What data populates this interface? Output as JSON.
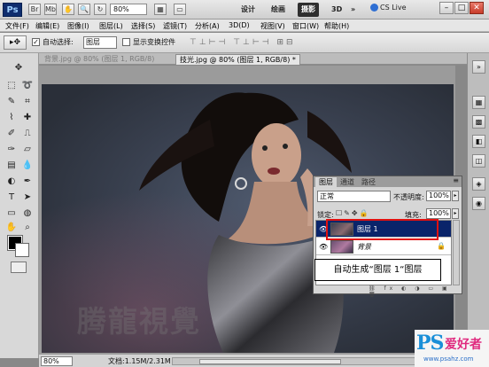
{
  "appbar": {
    "logo": "Ps",
    "zoom_value": "80%",
    "workspaces": [
      {
        "label": "设计",
        "active": false
      },
      {
        "label": "绘画",
        "active": false
      },
      {
        "label": "摄影",
        "active": true
      },
      {
        "label": "3D",
        "active": false
      }
    ],
    "cs_live": "CS Live",
    "window_controls": [
      "minimize-icon",
      "maximize-icon",
      "close-icon"
    ]
  },
  "menubar": {
    "items": [
      "文件(F)",
      "编辑(E)",
      "图像(I)",
      "图层(L)",
      "选择(S)",
      "滤镜(T)",
      "分析(A)",
      "3D(D)",
      "视图(V)",
      "窗口(W)",
      "帮助(H)"
    ]
  },
  "options": {
    "auto_select_label": "自动选择:",
    "auto_select_value": "图层",
    "show_transform_label": "显示变换控件"
  },
  "doc_tabs": [
    {
      "label": "背景.jpg @ 80% (图层 1, RGB/8)",
      "active": false
    },
    {
      "label": "技光.jpg @ 80% (图层 1, RGB/8) *",
      "active": true
    }
  ],
  "canvas": {
    "watermark": "腾龍視覺"
  },
  "status": {
    "zoom": "80%",
    "doc_size": "文档:1.15M/2.31M"
  },
  "layers_panel": {
    "tabs": [
      {
        "label": "图层",
        "active": true
      },
      {
        "label": "通道",
        "active": false
      },
      {
        "label": "路径",
        "active": false
      }
    ],
    "blend_mode": "正常",
    "opacity_label": "不透明度:",
    "opacity_value": "100%",
    "lock_label": "锁定:",
    "fill_label": "填充:",
    "fill_value": "100%",
    "layers": [
      {
        "name": "图层 1",
        "selected": true,
        "locked": false
      },
      {
        "name": "背景",
        "selected": false,
        "locked": true
      }
    ]
  },
  "callout": {
    "text": "自动生成“图层 1“图层"
  },
  "badge": {
    "main": "PS",
    "cn": "爱好者",
    "url": "www.psahz.com"
  }
}
